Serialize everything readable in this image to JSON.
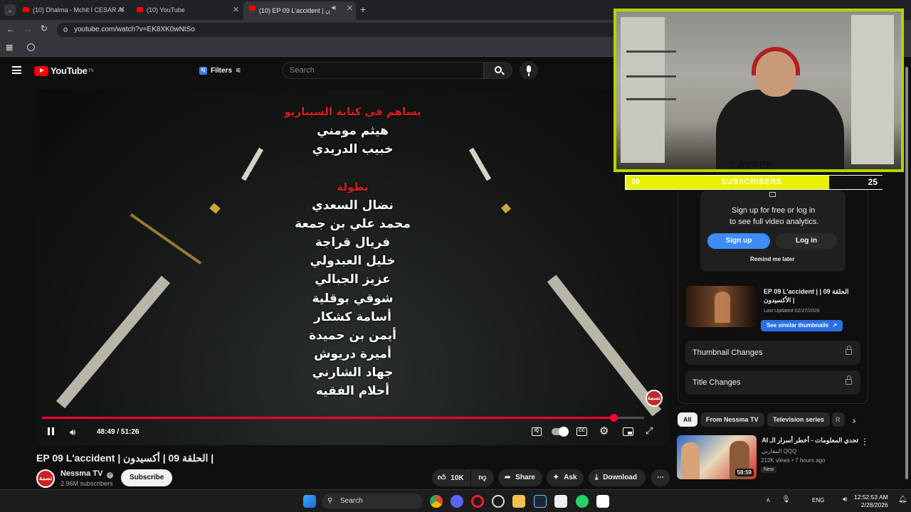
{
  "browser": {
    "tabs": [
      {
        "title": "(10) Dhalma - Mchit I CESAR AI",
        "active": false
      },
      {
        "title": "(10) YouTube",
        "active": false
      },
      {
        "title": "(10) EP 09 L'accident | أكسيدون",
        "active": true
      }
    ],
    "new_tab": "+",
    "url": "youtube.com/watch?v=EK8XK0wNtSo"
  },
  "youtube": {
    "logo_text": "YouTube",
    "logo_sup": "TN",
    "filters_label": "Filters",
    "filters_badge": "IQ",
    "search_placeholder": "Search"
  },
  "player": {
    "credits_top_header": "يساهم في كتابة السيناريو",
    "writers": [
      "هيثم مومني",
      "خبيب الدريدي"
    ],
    "cast_header": "بطولة",
    "cast": [
      "نضال السعدي",
      "محمد علي بن جمعة",
      "فريال قراجة",
      "خليل العبدولي",
      "عزيز الجبالي",
      "شوقي بوقلية",
      "أسامة كشكار",
      "أيمن بن حميدة",
      "أميرة دريوش",
      "جهاد الشارني",
      "أحلام الفقيه"
    ],
    "time": "48:49 / 51:26",
    "progress_fraction": 0.949,
    "bug_text": "نسمة",
    "iq_badge": "IQ"
  },
  "video": {
    "title": "EP 09 L'accident | الحلقة 09 | أكسيدون |",
    "channel": "Nessma TV",
    "subscribers": "2.96M subscribers",
    "subscribe_label": "Subscribe",
    "avatar_text": "نسمة",
    "likes": "10K",
    "share_label": "Share",
    "ask_label": "Ask",
    "download_label": "Download"
  },
  "overlay": {
    "sub_left": "20",
    "sub_label": "SUBSCRIBERS",
    "sub_right": "25",
    "streamer_logo": "LAYFER"
  },
  "analytics": {
    "signup_line1": "Sign up for free or log in",
    "signup_line2": "to see full video analytics.",
    "signup_btn": "Sign up",
    "login_btn": "Log in",
    "remind": "Remind me later",
    "video_title": "EP 09 L'accident | الحلقة 09 | الأكسيدون |",
    "last_updated": "Last Updated 02/27/2026",
    "see_similar": "See similar thumbnails",
    "thumbnail_changes": "Thumbnail Changes",
    "title_changes": "Title Changes"
  },
  "chips": [
    "All",
    "From Nessma TV",
    "Television series",
    "R"
  ],
  "recommendation": {
    "title": "تحدي المعلومات - أخطر أسرار الـ AI",
    "channel": "المغاربي QQQ",
    "meta": "212K views • 7 hours ago",
    "badge": "New",
    "duration": "58:59"
  },
  "taskbar": {
    "search": "Search",
    "lang": "ENG",
    "time": "12:52:53 AM",
    "date": "2/28/2026"
  },
  "colors": {
    "accent_red": "#ff0033",
    "youtube_red": "#ff0000",
    "overlay_yellow": "#e8f200",
    "button_blue": "#3e8cf7"
  }
}
